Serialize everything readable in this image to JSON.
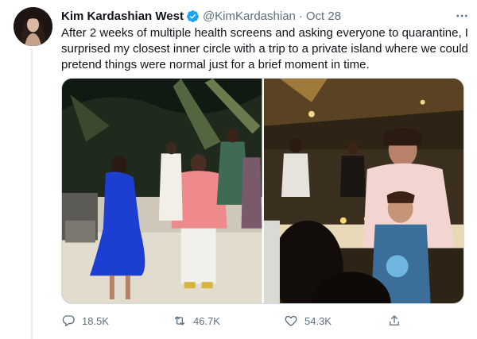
{
  "tweet": {
    "display_name": "Kim Kardashian West",
    "handle": "@KimKardashian",
    "separator": "·",
    "date": "Oct 28",
    "more_icon": "more-horizontal-icon",
    "verified_icon": "verified-badge-icon",
    "text": "After 2 weeks of multiple health screens and asking everyone to quarantine, I surprised my closest inner circle with a trip to a private island where we could pretend things were normal just for a brief moment in time.",
    "media": [
      {
        "description_icon": "photo-1"
      },
      {
        "description_icon": "photo-2"
      }
    ],
    "actions": {
      "replies": "18.5K",
      "retweets": "46.7K",
      "likes": "54.3K"
    }
  },
  "colors": {
    "text": "#0f1419",
    "secondary": "#5b7083",
    "verified": "#1da1f2",
    "border": "#cfd9de"
  }
}
